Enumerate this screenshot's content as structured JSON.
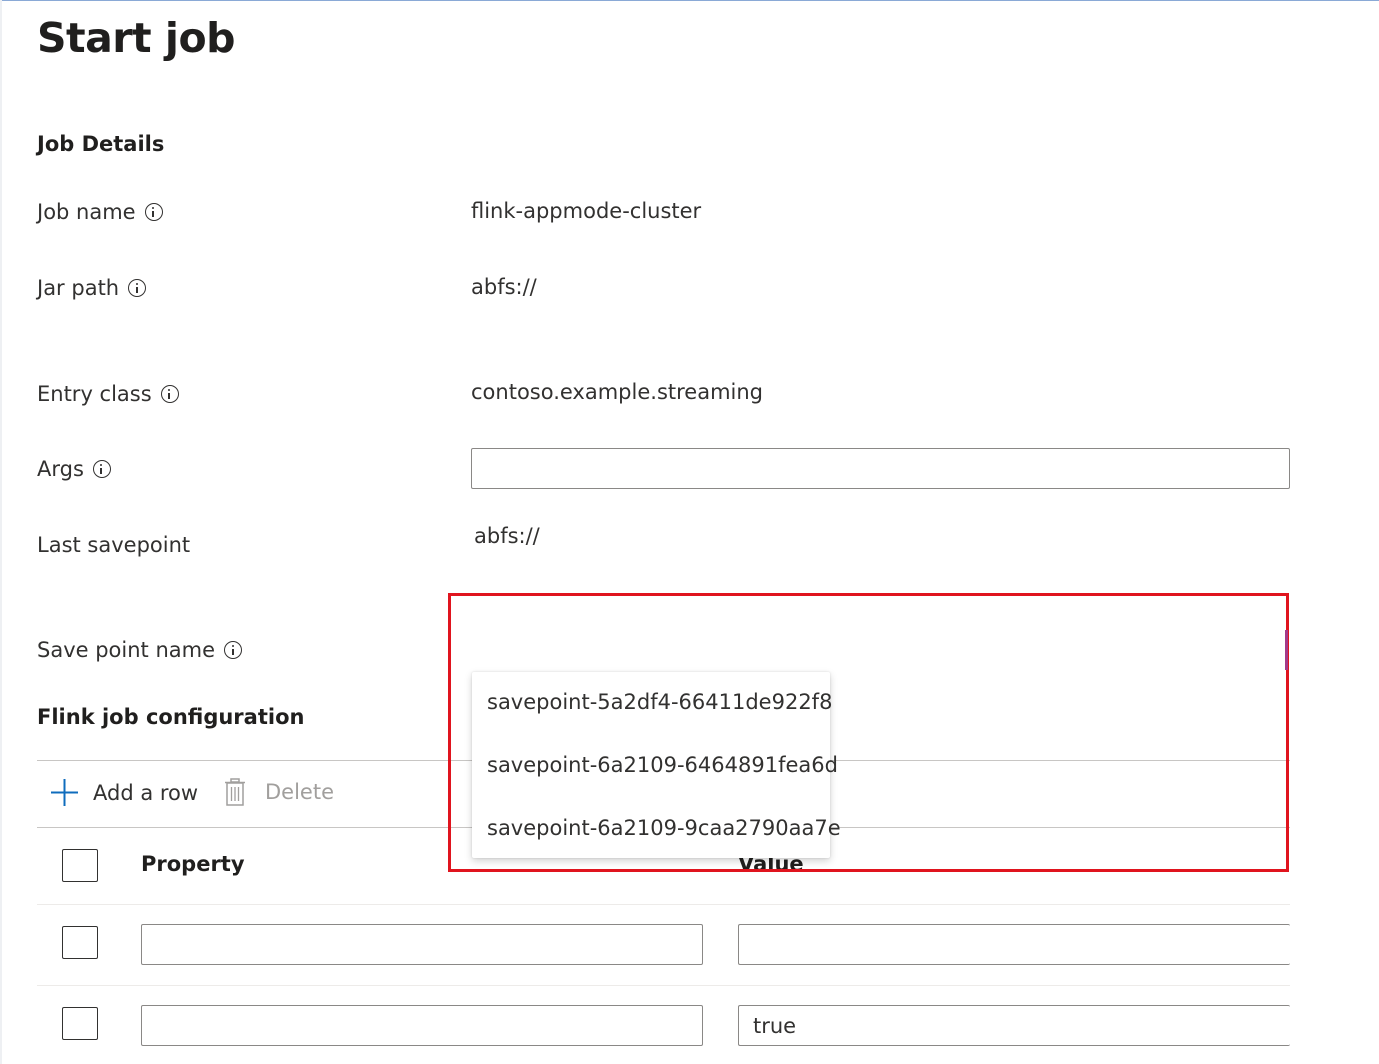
{
  "page": {
    "title": "Start job"
  },
  "job_details": {
    "heading": "Job Details",
    "job_name": {
      "label": "Job name",
      "value": "flink-appmode-cluster"
    },
    "jar_path": {
      "label": "Jar path",
      "value": "abfs://"
    },
    "entry_class": {
      "label": "Entry class",
      "value": "contoso.example.streaming"
    },
    "args": {
      "label": "Args",
      "value": ""
    },
    "last_savepoint": {
      "label": "Last savepoint",
      "value": "abfs://"
    },
    "save_point_name": {
      "label": "Save point name",
      "options": [
        "savepoint-5a2df4-66411de922f8",
        "savepoint-6a2109-6464891fea6d",
        "savepoint-6a2109-9caa2790aa7e"
      ]
    }
  },
  "flink_config": {
    "heading": "Flink job configuration",
    "toolbar": {
      "add_row": "Add a row",
      "delete": "Delete"
    },
    "columns": {
      "property": "Property",
      "value": "Value"
    },
    "rows": [
      {
        "property": "",
        "value": ""
      },
      {
        "property": "",
        "value": "true"
      }
    ]
  },
  "colors": {
    "highlight": "#e0141e",
    "accent_blue": "#0f6cbd",
    "disabled": "#a19f9d"
  },
  "icons": {
    "info": "info-icon",
    "add": "plus-icon",
    "delete": "trash-icon"
  }
}
